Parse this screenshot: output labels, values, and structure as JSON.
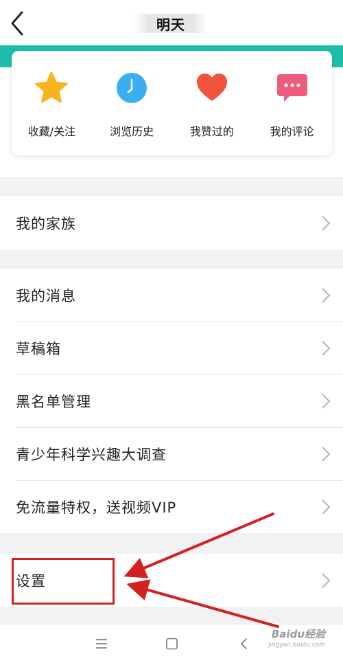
{
  "header": {
    "title": "明天"
  },
  "quick_actions": [
    {
      "label": "收藏/关注",
      "icon": "star-icon"
    },
    {
      "label": "浏览历史",
      "icon": "clock-icon"
    },
    {
      "label": "我赞过的",
      "icon": "heart-icon"
    },
    {
      "label": "我的评论",
      "icon": "comment-icon"
    }
  ],
  "menu": {
    "group1": [
      {
        "label": "我的家族"
      }
    ],
    "group2": [
      {
        "label": "我的消息"
      },
      {
        "label": "草稿箱"
      },
      {
        "label": "黑名单管理"
      },
      {
        "label": "青少年科学兴趣大调查"
      },
      {
        "label": "免流量特权，送视频VIP"
      }
    ],
    "group3": [
      {
        "label": "设置"
      }
    ]
  },
  "watermark": {
    "brand": "Baidu经验",
    "url": "jingyan.baidu.com"
  },
  "colors": {
    "accent": "#1dbfaa",
    "star": "#f9b320",
    "clock": "#39aef0",
    "heart": "#f2533f",
    "comment": "#ef5b7b",
    "annotation": "#d42020"
  }
}
